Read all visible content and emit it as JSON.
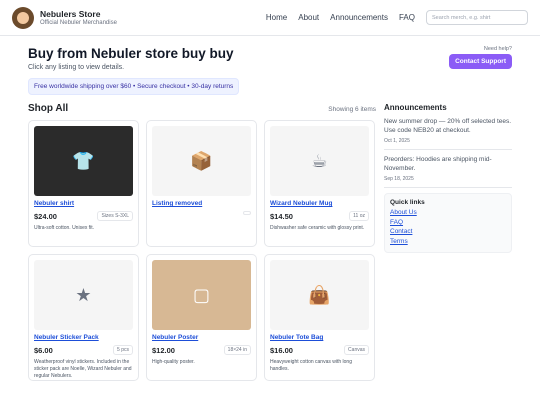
{
  "header": {
    "brand_name": "Nebulers Store",
    "brand_sub": "Official Nebuler Merchandise",
    "nav": [
      "Home",
      "About",
      "Announcements",
      "FAQ"
    ],
    "search_placeholder": "Search merch, e.g. shirt"
  },
  "hero": {
    "title": "Buy from Nebuler store buy buy",
    "subtitle": "Click any listing to view details.",
    "shipping": "Free worldwide shipping over $60 • Secure checkout • 30-day returns",
    "help_q": "Need help?",
    "cta": "Contact Support"
  },
  "shop": {
    "title": "Shop All",
    "count": "Showing 6 items",
    "products": [
      {
        "title": "Nebuler shirt",
        "price": "$24.00",
        "badge": "Sizes S-3XL",
        "desc": "Ultra-soft cotton. Unisex fit.",
        "icon": "shirt-icon"
      },
      {
        "title": "Listing removed",
        "price": "",
        "badge": "",
        "desc": "",
        "icon": "box-icon"
      },
      {
        "title": "Wizard Nebuler Mug",
        "price": "$14.50",
        "badge": "11 oz",
        "desc": "Dishwasher safe ceramic with glossy print.",
        "icon": "mug-icon"
      },
      {
        "title": "Nebuler Sticker Pack",
        "price": "$6.00",
        "badge": "5 pcs",
        "desc": "Weatherproof vinyl stickers. Included in the sticker pack are Noelle, Wizard Nebuler and regular Nebulers.",
        "icon": "sticker-icon"
      },
      {
        "title": "Nebuler Poster",
        "price": "$12.00",
        "badge": "18×24 in",
        "desc": "High-quality poster.",
        "icon": "poster-icon"
      },
      {
        "title": "Nebuler Tote Bag",
        "price": "$16.00",
        "badge": "Canvas",
        "desc": "Heavyweight cotton canvas with long handles.",
        "icon": "tote-icon"
      }
    ]
  },
  "sidebar": {
    "ann_title": "Announcements",
    "ann1": "New summer drop — 20% off selected tees. Use code NEB20 at checkout.",
    "ann1_date": "Oct 1, 2025",
    "ann2": "Preorders: Hoodies are shipping mid-November.",
    "ann2_date": "Sep 18, 2025",
    "quick_title": "Quick links",
    "links": [
      "About Us",
      "FAQ",
      "Contact",
      "Terms"
    ]
  },
  "colors": {
    "accent": "#8b5cf6",
    "link": "#1d4ed8"
  }
}
